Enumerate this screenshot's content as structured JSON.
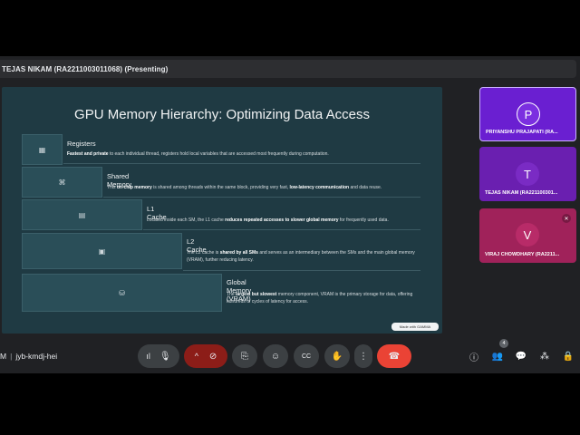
{
  "presenter_label": "TEJAS NIKAM (RA2211003011068) (Presenting)",
  "slide": {
    "title": "GPU Memory Hierarchy: Optimizing Data Access",
    "tiers": [
      {
        "heading": "Registers",
        "icon": "grid-icon",
        "desc_bold1": "Fastest and private",
        "desc1": " to each individual thread, registers hold local variables that are accessed most frequently during computation.",
        "desc_bold2": "",
        "desc2": ""
      },
      {
        "heading": "Shared Memory",
        "icon": "network-icon",
        "desc_pre": "This ",
        "desc_bold1": "on-chip memory",
        "desc1": " is shared among threads within the same block, providing very fast, ",
        "desc_bold2": "low-latency communication",
        "desc2": " and data reuse."
      },
      {
        "heading": "L1 Cache",
        "icon": "layers-icon",
        "desc_pre": "Located inside each SM, the L1 cache ",
        "desc_bold1": "reduces repeated accesses to slower global memory",
        "desc1": " for frequently used data.",
        "desc_bold2": "",
        "desc2": ""
      },
      {
        "heading": "L2 Cache",
        "icon": "chip-icon",
        "desc_pre": "The L2 cache is ",
        "desc_bold1": "shared by all SMs",
        "desc1": " and serves as an intermediary between the SMs and the main global memory (VRAM), further reducing latency.",
        "desc_bold2": "",
        "desc2": ""
      },
      {
        "heading": "Global Memory (VRAM)",
        "icon": "storage-icon",
        "desc_pre": "The ",
        "desc_bold1": "largest but slowest",
        "desc1": " memory component, VRAM is the primary storage for data, offering hundreds of cycles of latency for access.",
        "desc_bold2": "",
        "desc2": ""
      }
    ],
    "badge": "Made with GAMMA"
  },
  "participants": [
    {
      "initial": "P",
      "name": "PRIYANSHU PRAJAPATI (RA...",
      "color": "#6a1fd1",
      "avatar_color": "#7b2fe0",
      "muted": false,
      "highlighted": true
    },
    {
      "initial": "T",
      "name": "TEJAS NIKAM (RA221100301...",
      "color": "#6a1fb0",
      "avatar_color": "#7a2bc4",
      "muted": false,
      "highlighted": false
    },
    {
      "initial": "V",
      "name": "VIRAJ CHOWDHARY (RA2211...",
      "color": "#a0225a",
      "avatar_color": "#b82b68",
      "muted": true,
      "highlighted": false
    }
  ],
  "toolbar": {
    "meeting_prefix": "M",
    "meeting_code": "jyb-kmdj-hei",
    "people_count": "4"
  },
  "icons": {
    "mic": "🎙",
    "chevron": "^",
    "camera_off": "⊘",
    "present": "⎘",
    "emoji": "☺",
    "captions": "CC",
    "hand": "✋",
    "more": "⋮",
    "end": "☎",
    "info": "ⓘ",
    "people": "👥",
    "chat": "💬",
    "activities": "⁂",
    "lock": "🔒"
  }
}
